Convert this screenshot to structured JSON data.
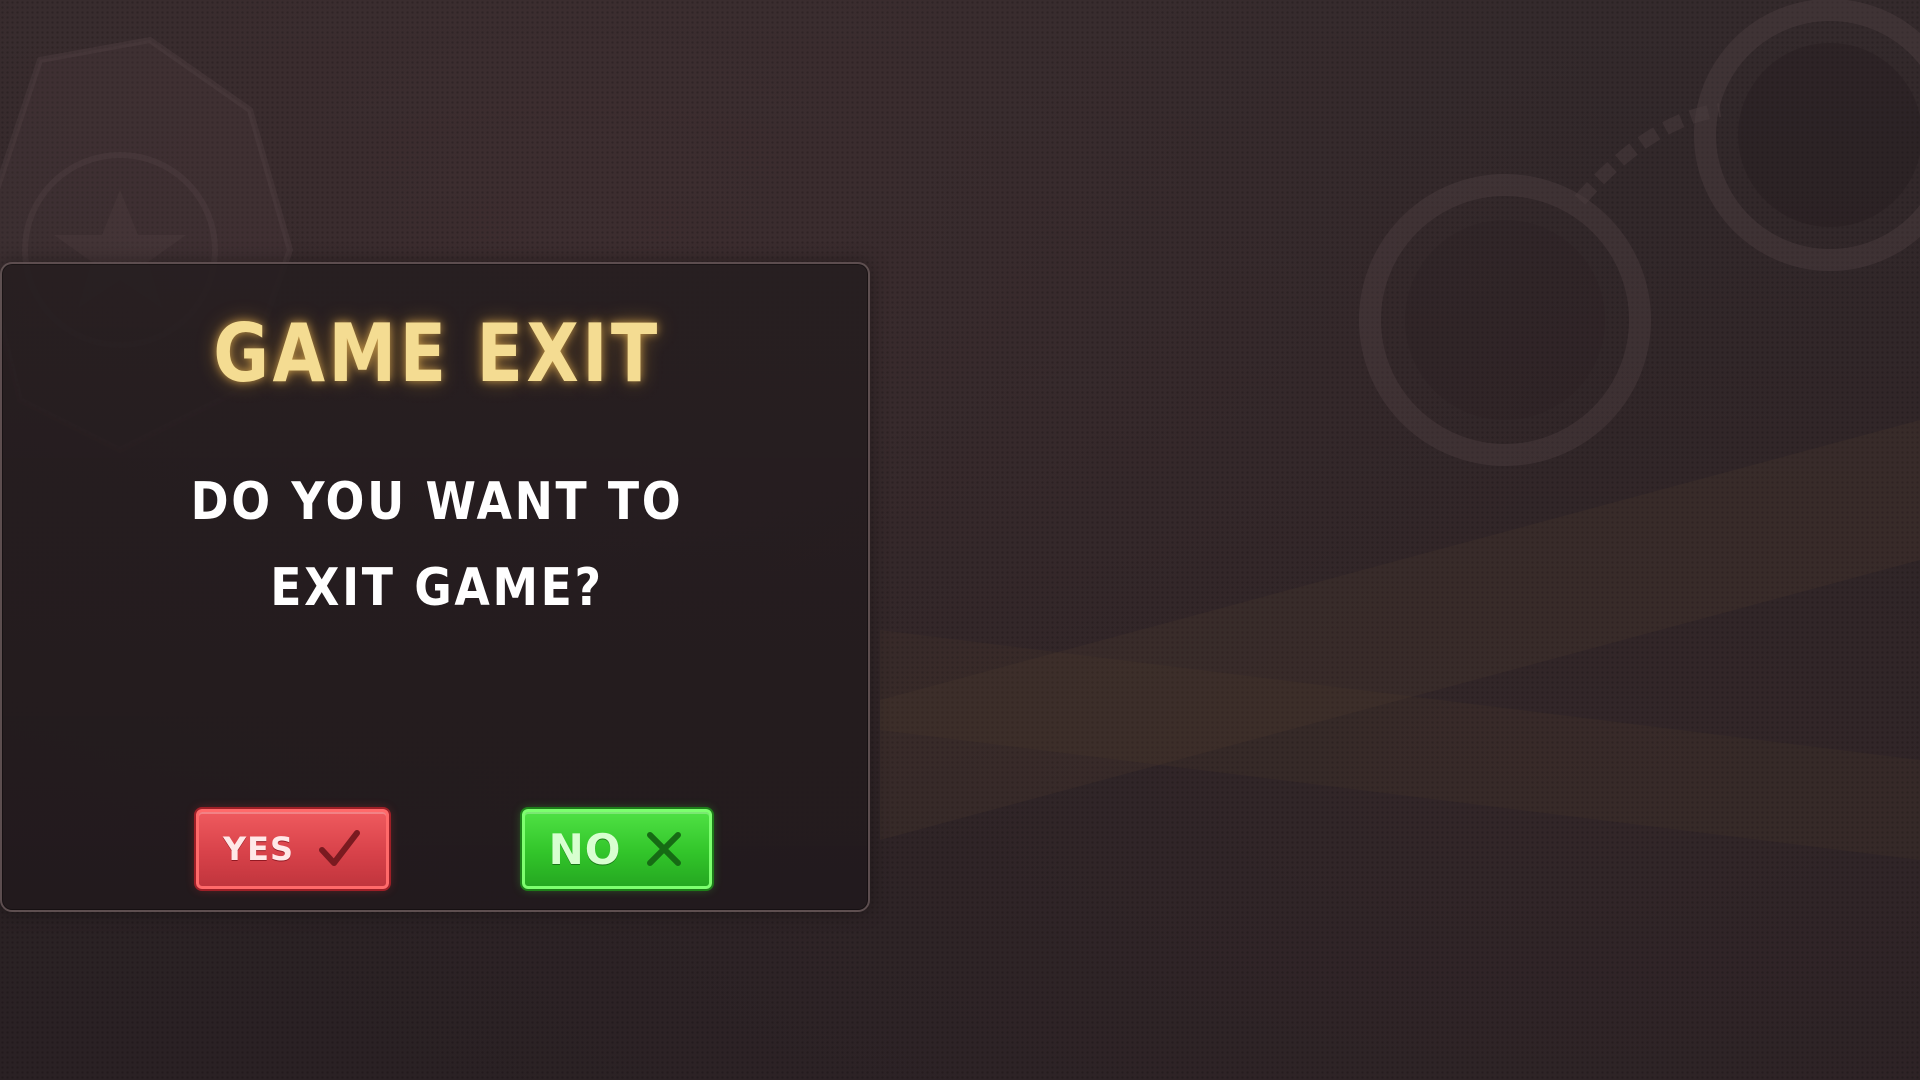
{
  "dialog": {
    "title": "GAME EXIT",
    "message_line1": "DO YOU WANT TO",
    "message_line2": "EXIT GAME?"
  },
  "buttons": {
    "yes": {
      "label": "YES",
      "icon": "checkmark-icon",
      "color": "#d8424a"
    },
    "no": {
      "label": "NO",
      "icon": "x-close-icon",
      "color": "#32c52a"
    }
  },
  "colors": {
    "background": "#2f2527",
    "title": "#f4dc92",
    "message": "#ffffff"
  }
}
